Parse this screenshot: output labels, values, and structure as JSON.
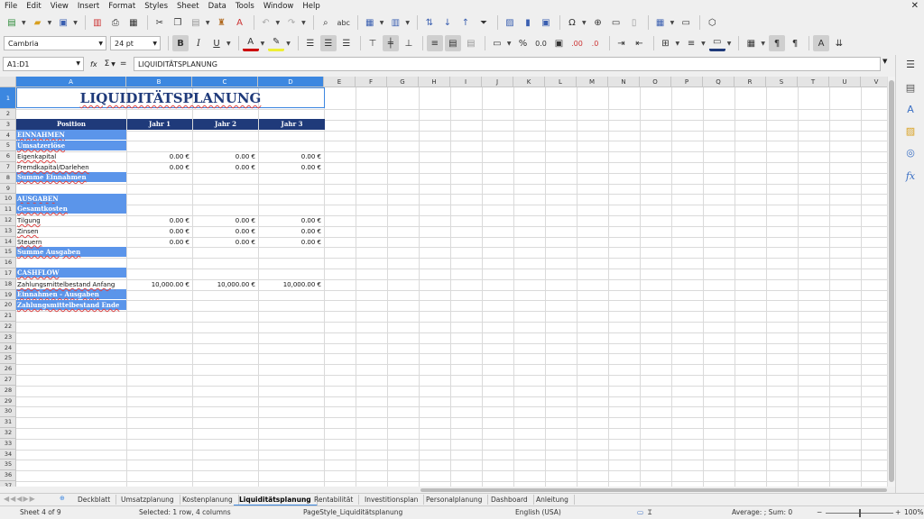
{
  "menubar": {
    "items": [
      "File",
      "Edit",
      "View",
      "Insert",
      "Format",
      "Styles",
      "Sheet",
      "Data",
      "Tools",
      "Window",
      "Help"
    ],
    "close_glyph": "✕"
  },
  "toolbar": {
    "font_name": "Cambria",
    "font_size": "24 pt"
  },
  "formula_bar": {
    "name_box": "A1:D1",
    "content": "LIQUIDITÄTSPLANUNG",
    "sum_icon": "Σ",
    "equals_icon": "="
  },
  "columns": [
    {
      "label": "A",
      "selected": true
    },
    {
      "label": "B",
      "selected": true
    },
    {
      "label": "C",
      "selected": true
    },
    {
      "label": "D",
      "selected": true
    },
    {
      "label": "E"
    },
    {
      "label": "F"
    },
    {
      "label": "G"
    },
    {
      "label": "H"
    },
    {
      "label": "I"
    },
    {
      "label": "J"
    },
    {
      "label": "K"
    },
    {
      "label": "L"
    },
    {
      "label": "M"
    },
    {
      "label": "N"
    },
    {
      "label": "O"
    },
    {
      "label": "P"
    },
    {
      "label": "Q"
    },
    {
      "label": "R"
    },
    {
      "label": "S"
    },
    {
      "label": "T"
    },
    {
      "label": "U"
    },
    {
      "label": "V"
    }
  ],
  "rows": [
    "1",
    "2",
    "3",
    "4",
    "5",
    "6",
    "7",
    "8",
    "9",
    "10",
    "11",
    "12",
    "13",
    "14",
    "15",
    "16",
    "17",
    "18",
    "19",
    "20",
    "21",
    "22",
    "23",
    "24",
    "25",
    "26",
    "27",
    "28",
    "29",
    "30",
    "31",
    "32",
    "33",
    "34",
    "35",
    "36",
    "37"
  ],
  "sheet": {
    "title": "LIQUIDITÄTSPLANUNG",
    "header": {
      "position": "Position",
      "jahr1": "Jahr 1",
      "jahr2": "Jahr 2",
      "jahr3": "Jahr 3"
    },
    "bands": {
      "einnahmen": "EINNAHMEN",
      "umsatzerloese": "Umsatzerlöse",
      "summe_einnahmen": "Summe Einnahmen",
      "ausgaben": "AUSGABEN",
      "gesamtkosten": "Gesamtkosten",
      "summe_ausgaben": "Summe Ausgaben",
      "cashflow": "CASHFLOW",
      "einnahmen_ausgaben": "Einnahmen - Ausgaben",
      "bestand_ende": "Zahlungsmittelbestand Ende"
    },
    "data_rows": [
      {
        "label": "Eigenkapital",
        "v1": "0.00 €",
        "v2": "0.00 €",
        "v3": "0.00 €"
      },
      {
        "label": "Fremdkapital/Darlehen",
        "v1": "0.00 €",
        "v2": "0.00 €",
        "v3": "0.00 €"
      },
      {
        "label": "Tilgung",
        "v1": "0.00 €",
        "v2": "0.00 €",
        "v3": "0.00 €"
      },
      {
        "label": "Zinsen",
        "v1": "0.00 €",
        "v2": "0.00 €",
        "v3": "0.00 €"
      },
      {
        "label": "Steuern",
        "v1": "0.00 €",
        "v2": "0.00 €",
        "v3": "0.00 €"
      },
      {
        "label": "Zahlungsmittelbestand Anfang",
        "v1": "10,000.00 €",
        "v2": "10,000.00 €",
        "v3": "10,000.00 €"
      }
    ]
  },
  "tabs": {
    "items": [
      "Deckblatt",
      "Umsatzplanung",
      "Kostenplanung",
      "Liquiditätsplanung",
      "Rentabilität",
      "Investitionsplan",
      "Personalplanung",
      "Dashboard",
      "Anleitung"
    ],
    "active": "Liquiditätsplanung"
  },
  "status": {
    "sheet": "Sheet 4 of 9",
    "selection": "Selected: 1 row, 4 columns",
    "page_style": "PageStyle_Liquiditätsplanung",
    "language": "English (USA)",
    "summary": "Average: ; Sum: 0",
    "zoom": "100%",
    "zoom_minus": "−",
    "zoom_plus": "+"
  },
  "icons": {
    "new": "new-document-icon",
    "open": "open-folder-icon",
    "save": "save-icon",
    "pdf": "export-pdf-icon",
    "print": "print-icon",
    "preview": "print-preview-icon",
    "cut": "cut-icon",
    "copy": "copy-icon",
    "paste": "paste-icon",
    "clone": "clone-formatting-icon",
    "clear": "clear-formatting-icon",
    "undo": "undo-icon",
    "redo": "redo-icon",
    "find": "find-replace-icon",
    "spell": "spellcheck-icon",
    "row": "row-icon",
    "column": "column-icon",
    "sort": "sort-icon",
    "sort_asc": "sort-ascending-icon",
    "sort_desc": "sort-descending-icon",
    "autofilter": "autofilter-icon",
    "image": "insert-image-icon",
    "chart": "insert-chart-icon",
    "pivot": "pivot-table-icon",
    "special_char": "special-character-icon",
    "hyperlink": "hyperlink-icon",
    "comment": "comment-icon",
    "header_footer": "header-footer-icon",
    "freeze": "freeze-rows-columns-icon",
    "split": "split-window-icon",
    "shapes": "shapes-icon"
  },
  "colors": {
    "header_band": "#1f3a7a",
    "section_band": "#5b95ea",
    "selection": "#3c87e0",
    "title_text": "#1f3a7a"
  }
}
